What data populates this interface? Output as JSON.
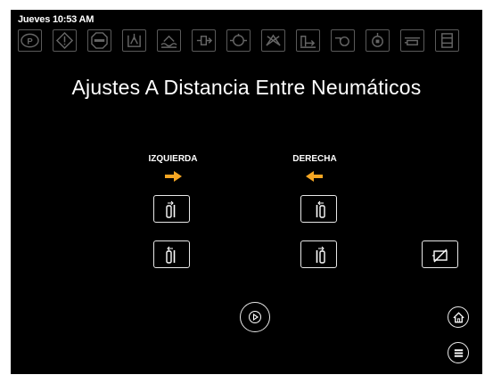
{
  "status": {
    "datetime": "Jueves 10:53 AM"
  },
  "header": {
    "title": "Ajustes A Distancia Entre Neumáticos"
  },
  "columns": {
    "left": {
      "label": "IZQUIERDA"
    },
    "right": {
      "label": "DERECHA"
    }
  },
  "icon_bar": [
    "parking-brake-icon",
    "warning-icon",
    "stop-icon",
    "grain-tank-icon",
    "engine-temp-icon",
    "fuel-icon",
    "tire-pressure-icon",
    "spray-icon",
    "unload-icon",
    "oil-icon",
    "hydraulic-icon",
    "filter-icon",
    "container-icon"
  ],
  "colors": {
    "accent": "#f5a623",
    "icon_inactive": "#5a5a5a",
    "background": "#000000",
    "foreground": "#ffffff"
  }
}
